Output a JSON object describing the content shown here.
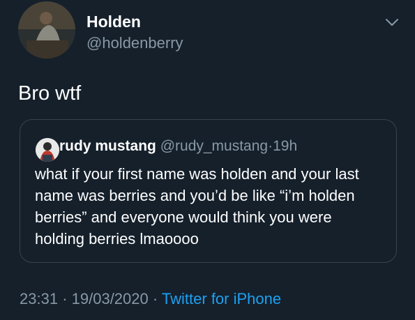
{
  "tweet": {
    "author": {
      "name": "Holden",
      "handle": "@holdenberry"
    },
    "text": "Bro wtf",
    "menu_icon": "chevron-down-icon",
    "quote": {
      "author_name": "rudy mustang",
      "author_handle": "@rudy_mustang",
      "separator": "·",
      "time": "19h",
      "text": "what if your first name was holden and your last name was berries and you’d be like “i’m holden berries” and everyone would think you were holding berries lmaoooo"
    },
    "meta": {
      "time": "23:31",
      "date": "19/03/2020",
      "separator": "·",
      "source": "Twitter for iPhone"
    }
  },
  "colors": {
    "background": "#15202b",
    "text": "#ffffff",
    "secondary": "#8899a6",
    "accent": "#1da1f2",
    "border": "#38444d"
  }
}
